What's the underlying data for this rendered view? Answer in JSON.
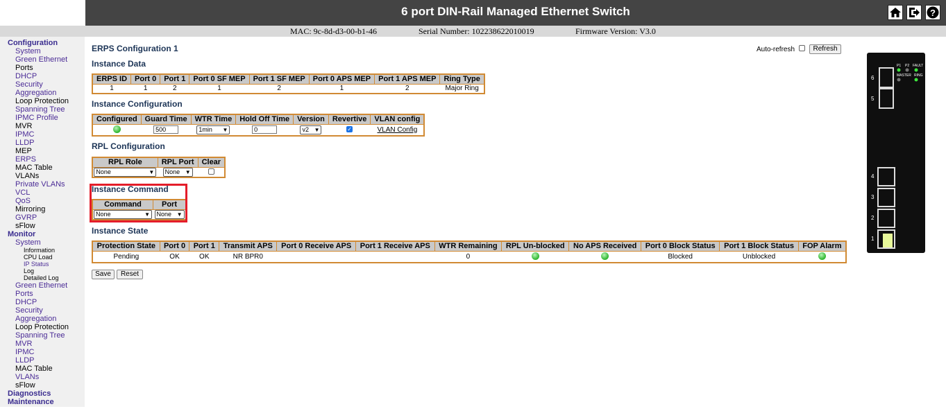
{
  "header": {
    "title": "6 port DIN-Rail Managed Ethernet Switch",
    "mac": "MAC: 9c-8d-d3-00-b1-46",
    "serial": "Serial Number: 102238622010019",
    "firmware": "Firmware Version: V3.0",
    "icons": [
      "home-icon",
      "logout-icon",
      "help-icon"
    ]
  },
  "sidebar": {
    "configuration": "Configuration",
    "config_items": [
      "System",
      "Green Ethernet",
      "Ports",
      "DHCP",
      "Security",
      "Aggregation",
      "Loop Protection",
      "Spanning Tree",
      "IPMC Profile",
      "MVR",
      "IPMC",
      "LLDP",
      "MEP",
      "ERPS",
      "MAC Table",
      "VLANs",
      "Private VLANs",
      "VCL",
      "QoS",
      "Mirroring",
      "GVRP",
      "sFlow"
    ],
    "monitor": "Monitor",
    "monitor_system": "System",
    "monitor_sub": [
      "Information",
      "CPU Load",
      "IP Status",
      "Log",
      "Detailed Log"
    ],
    "monitor_items": [
      "Green Ethernet",
      "Ports",
      "DHCP",
      "Security",
      "Aggregation",
      "Loop Protection",
      "Spanning Tree",
      "MVR",
      "IPMC",
      "LLDP",
      "MAC Table",
      "VLANs",
      "sFlow"
    ],
    "diagnostics": "Diagnostics",
    "maintenance": "Maintenance"
  },
  "page": {
    "title": "ERPS Configuration 1",
    "auto_refresh_label": "Auto-refresh",
    "refresh_button": "Refresh",
    "save_button": "Save",
    "reset_button": "Reset"
  },
  "instance_data": {
    "heading": "Instance Data",
    "headers": [
      "ERPS ID",
      "Port 0",
      "Port 1",
      "Port 0 SF MEP",
      "Port 1 SF MEP",
      "Port 0 APS MEP",
      "Port 1 APS MEP",
      "Ring Type"
    ],
    "row": [
      "1",
      "1",
      "2",
      "1",
      "2",
      "1",
      "2",
      "Major Ring"
    ]
  },
  "instance_config": {
    "heading": "Instance Configuration",
    "headers": [
      "Configured",
      "Guard Time",
      "WTR Time",
      "Hold Off Time",
      "Version",
      "Revertive",
      "VLAN config"
    ],
    "guard_time": "500",
    "wtr_time": "1min",
    "hold_off_time": "0",
    "version": "v2",
    "revertive_checked": true,
    "vlan_link": "VLAN Config"
  },
  "rpl_config": {
    "heading": "RPL Configuration",
    "headers": [
      "RPL Role",
      "RPL Port",
      "Clear"
    ],
    "role": "None",
    "port": "None"
  },
  "instance_command": {
    "heading": "Instance Command",
    "headers": [
      "Command",
      "Port"
    ],
    "command": "None",
    "port": "None"
  },
  "instance_state": {
    "heading": "Instance State",
    "headers": [
      "Protection State",
      "Port 0",
      "Port 1",
      "Transmit APS",
      "Port 0 Receive APS",
      "Port 1 Receive APS",
      "WTR Remaining",
      "RPL Un-blocked",
      "No APS Received",
      "Port 0 Block Status",
      "Port 1 Block Status",
      "FOP Alarm"
    ],
    "protection_state": "Pending",
    "port0": "OK",
    "port1": "OK",
    "transmit_aps": "NR BPR0",
    "port0_receive_aps": "",
    "port1_receive_aps": "",
    "wtr_remaining": "0",
    "port0_block": "Blocked",
    "port1_block": "Unblocked"
  },
  "device": {
    "led_labels": [
      "P1",
      "P2",
      "FAULT",
      "MASTER",
      "RING"
    ],
    "port_labels": [
      "6",
      "5",
      "4",
      "3",
      "2",
      "1"
    ]
  },
  "colors": {
    "header_bg": "#444444",
    "table_border": "#d18a33",
    "link_purple": "#4b2c96",
    "highlight_red": "#e41d2a",
    "led_green": "#2bb52b"
  }
}
